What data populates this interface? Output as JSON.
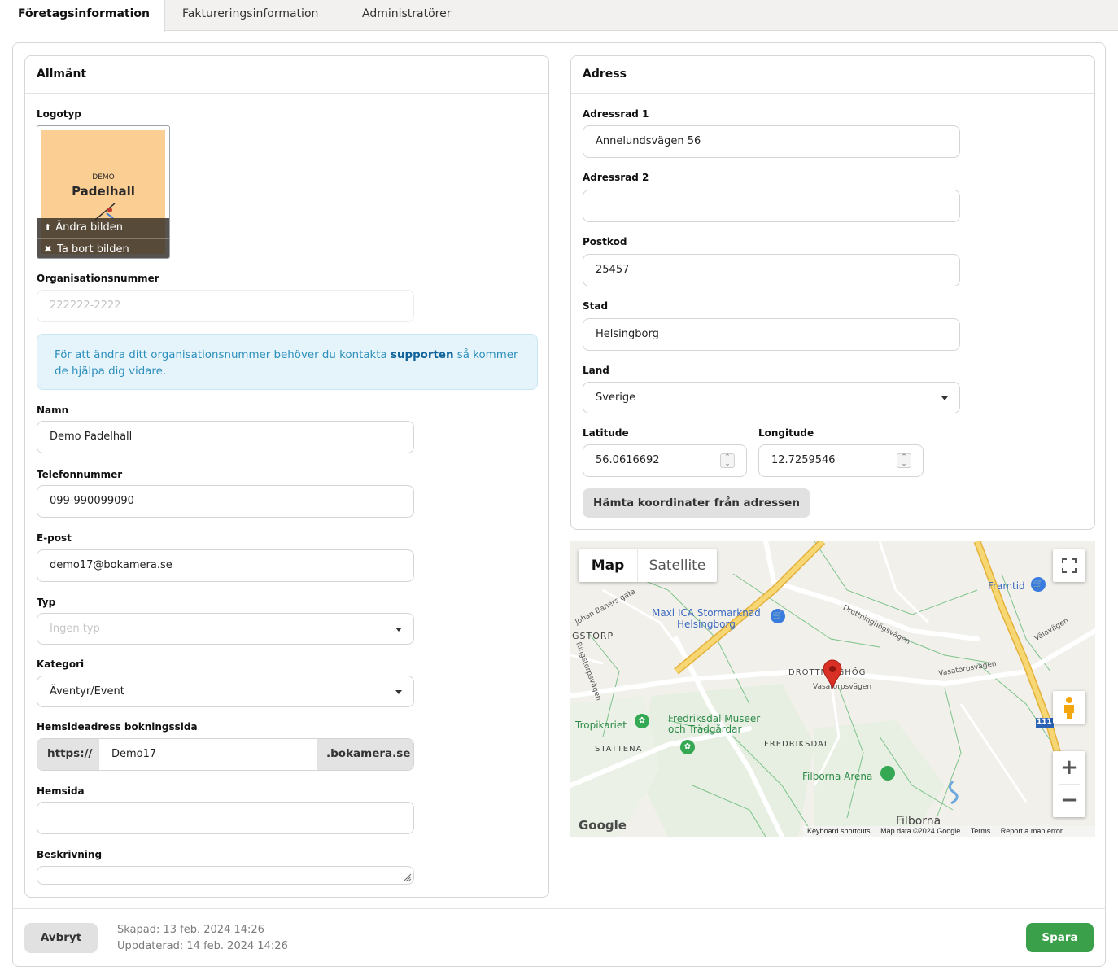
{
  "tabs": [
    {
      "label": "Företagsinformation",
      "active": true
    },
    {
      "label": "Faktureringsinformation",
      "active": false
    },
    {
      "label": "Administratörer",
      "active": false
    }
  ],
  "general": {
    "title": "Allmänt",
    "logo_label": "Logotyp",
    "logo_demo": "DEMO",
    "logo_name": "Padelhall",
    "change_image": "Ändra bilden",
    "remove_image": "Ta bort bilden",
    "org_label": "Organisationsnummer",
    "org_placeholder": "222222-2222",
    "info_text": "För att ändra ditt organisationsnummer behöver du kontakta",
    "info_link": "supporten",
    "info_text_2": "så kommer",
    "info_text_3": "de hjälpa dig vidare.",
    "name_label": "Namn",
    "name_value": "Demo Padelhall",
    "phone_label": "Telefonnummer",
    "phone_value": "099-990099090",
    "email_label": "E-post",
    "email_value": "demo17@bokamera.se",
    "type_label": "Typ",
    "type_placeholder": "Ingen typ",
    "category_label": "Kategori",
    "category_value": "Äventyr/Event",
    "booking_label": "Hemsideadress bokningssida",
    "booking_prefix": "https://",
    "booking_value": "Demo17",
    "booking_suffix": ".bokamera.se",
    "website_label": "Hemsida",
    "website_value": "",
    "description_label": "Beskrivning"
  },
  "address": {
    "title": "Adress",
    "line1_label": "Adressrad 1",
    "line1_value": "Annelundsvägen 56",
    "line2_label": "Adressrad 2",
    "line2_value": "",
    "postcode_label": "Postkod",
    "postcode_value": "25457",
    "city_label": "Stad",
    "city_value": "Helsingborg",
    "country_label": "Land",
    "country_value": "Sverige",
    "lat_label": "Latitude",
    "lat_value": "56.0616692",
    "lng_label": "Longitude",
    "lng_value": "12.7259546",
    "fetch_button": "Hämta koordinater från adressen"
  },
  "map": {
    "map_tab": "Map",
    "satellite_tab": "Satellite",
    "zoom_in": "+",
    "zoom_out": "−",
    "labels": {
      "gstorp": "GSTORP",
      "maxi1": "Maxi ICA Stormarknad",
      "maxi2": "Helsingborg",
      "framtid": "Framtid",
      "drottninghog": "DROTTNINGHÖG",
      "vasatorpsvagen": "Vasatorpsvägen",
      "tropikariet": "Tropikariet",
      "fredriksdal1": "Fredriksdal Museer",
      "fredriksdal2": "och Trädgårdar",
      "stattena": "STATTENA",
      "fredriksdal": "FREDRIKSDAL",
      "filborna_arena": "Filborna Arena",
      "filborna": "Filborna",
      "google": "Google",
      "shortcuts": "Keyboard shortcuts",
      "mapdata": "Map data ©2024 Google",
      "terms": "Terms",
      "report": "Report a map error",
      "drottninghogsvagen": "Drottninghögsvägen",
      "valavagen": "Välavägen",
      "johan": "Johan Banérs gata",
      "ringstorp": "Ringstorpsvägen",
      "road111": "111"
    }
  },
  "footer": {
    "cancel": "Avbryt",
    "created": "Skapad: 13 feb. 2024 14:26",
    "updated": "Uppdaterad: 14 feb. 2024 14:26",
    "save": "Spara"
  },
  "colors": {
    "accent_green": "#3aa04a",
    "info_bg": "#e5f3fa",
    "info_text": "#2d8fbc",
    "logo_bg": "#fbcf93",
    "map_road": "#f5c84c",
    "map_pin": "#d93025"
  }
}
